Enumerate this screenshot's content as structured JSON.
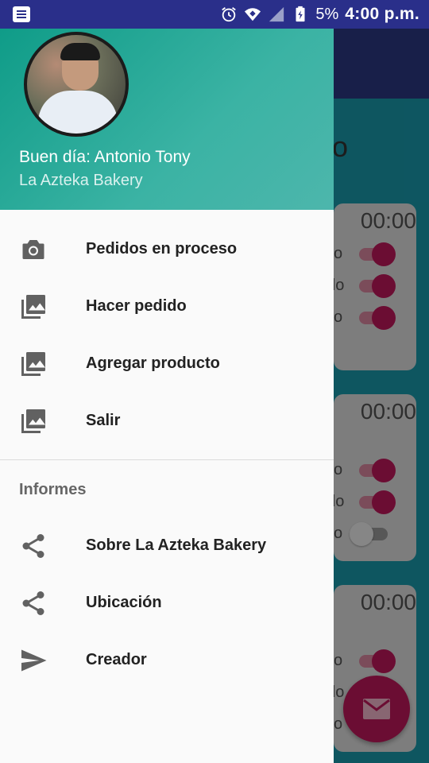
{
  "status_bar": {
    "battery_percent": "5%",
    "time": "4:00 p.m."
  },
  "background_screen": {
    "title_partial": "so",
    "cards": [
      {
        "time": "00:00",
        "rows": [
          {
            "text": "isto",
            "on": true
          },
          {
            "text": "ndo",
            "on": true
          },
          {
            "text": "isto",
            "on": true
          }
        ]
      },
      {
        "time": "00:00",
        "rows": [
          {
            "text": "isto",
            "on": true
          },
          {
            "text": "ndo",
            "on": true
          },
          {
            "text": "isto",
            "on": false
          }
        ]
      },
      {
        "time": "00:00",
        "rows": [
          {
            "text": "isto",
            "on": true
          },
          {
            "text": "ndo",
            "on": true
          },
          {
            "text": "isto",
            "on": true
          }
        ]
      }
    ],
    "fab_icon": "mail-icon"
  },
  "drawer": {
    "greeting": "Buen día: Antonio Tony",
    "company": "La Azteka Bakery",
    "items": [
      {
        "label": "Pedidos en proceso",
        "icon": "camera-icon"
      },
      {
        "label": "Hacer pedido",
        "icon": "photo-library-icon"
      },
      {
        "label": "Agregar producto",
        "icon": "photo-library-icon"
      },
      {
        "label": "Salir",
        "icon": "photo-library-icon"
      }
    ],
    "section_title": "Informes",
    "section_items": [
      {
        "label": "Sobre La Azteka Bakery",
        "icon": "share-icon"
      },
      {
        "label": "Ubicación",
        "icon": "share-icon"
      },
      {
        "label": "Creador",
        "icon": "send-icon"
      }
    ]
  },
  "colors": {
    "status_bar": "#2a2f8a",
    "header_gradient_start": "#0f9c88",
    "header_gradient_end": "#4db6ac",
    "accent": "#c3195d",
    "icon_gray": "#616161"
  }
}
